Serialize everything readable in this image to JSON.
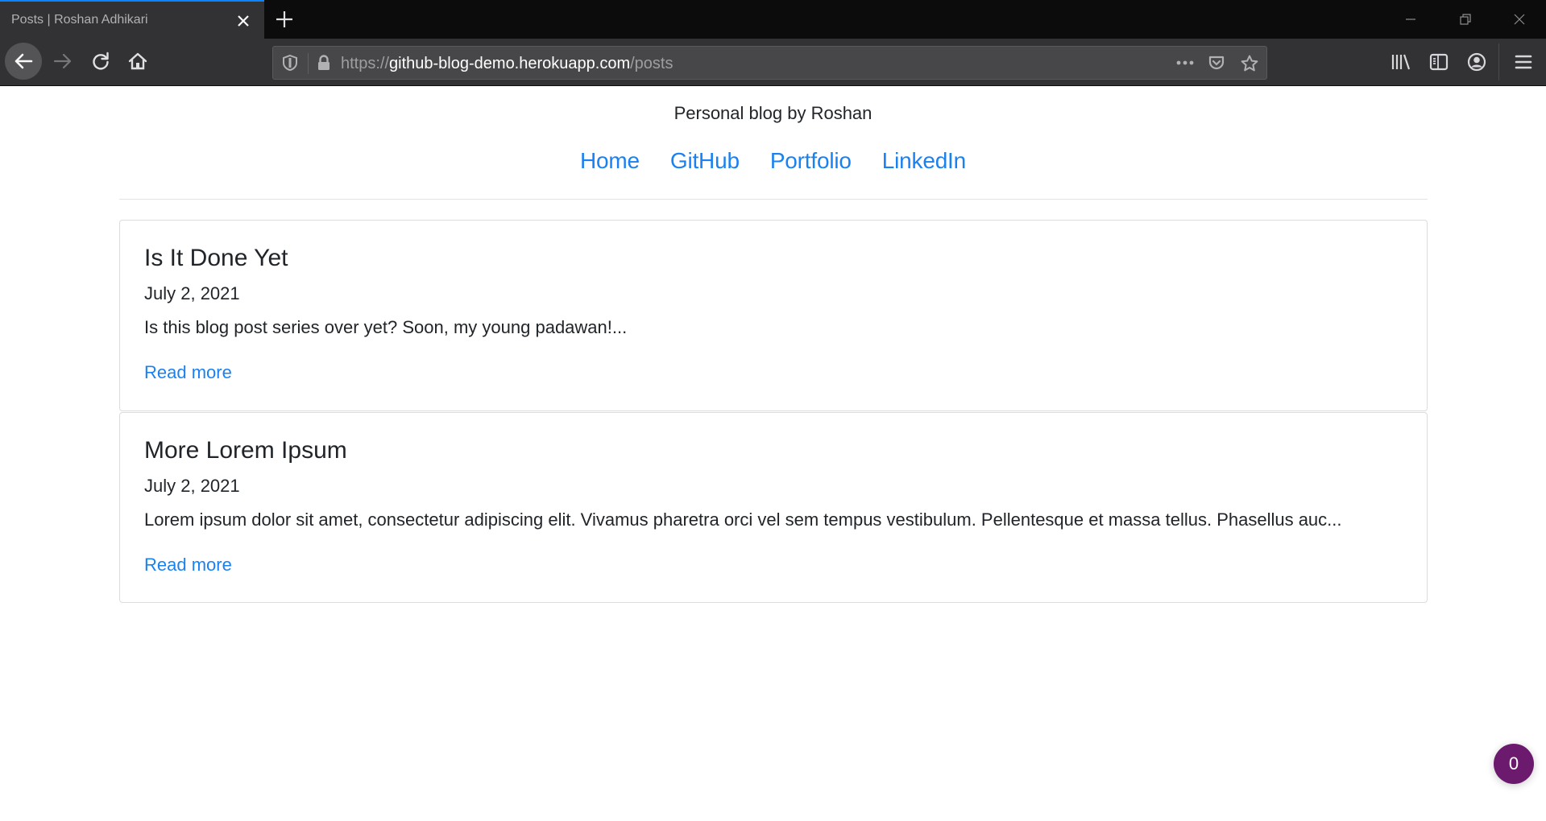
{
  "browser": {
    "tab": {
      "title": "Posts | Roshan Adhikari",
      "accent": "#0a84ff"
    },
    "url": {
      "scheme": "https://",
      "host": "github-blog-demo.herokuapp.com",
      "path": "/posts"
    },
    "icons": {
      "back": "arrow-left-icon",
      "forward": "arrow-right-icon",
      "reload": "reload-icon",
      "home": "home-icon",
      "tracking": "shield-icon",
      "lock": "lock-icon",
      "more": "ellipsis-icon",
      "pocket": "pocket-icon",
      "bookmark": "star-icon",
      "library": "library-icon",
      "sidebar": "sidebar-icon",
      "account": "account-icon",
      "menu": "hamburger-icon"
    }
  },
  "site": {
    "tagline": "Personal blog by Roshan",
    "nav": [
      {
        "label": "Home"
      },
      {
        "label": "GitHub"
      },
      {
        "label": "Portfolio"
      },
      {
        "label": "LinkedIn"
      }
    ],
    "link_color": "#1a82f0"
  },
  "posts": [
    {
      "title": "Is It Done Yet",
      "date": "July 2, 2021",
      "excerpt": "Is this blog post series over yet? Soon, my young padawan!...",
      "link_label": "Read more"
    },
    {
      "title": "More Lorem Ipsum",
      "date": "July 2, 2021",
      "excerpt": "Lorem ipsum dolor sit amet, consectetur adipiscing elit. Vivamus pharetra orci vel sem tempus vestibulum. Pellentesque et massa tellus. Phasellus auc...",
      "link_label": "Read more"
    }
  ],
  "floating_badge": {
    "count": "0",
    "color": "#6c1a6e"
  }
}
